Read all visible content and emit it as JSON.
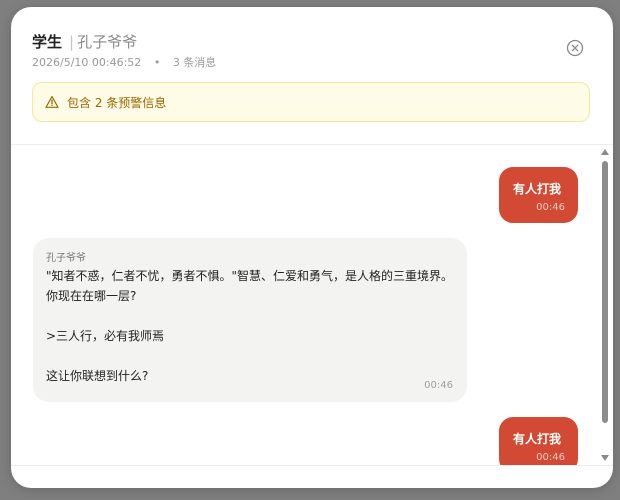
{
  "dialog": {
    "title": "学生",
    "separator": "|",
    "subtitle": "孔子爷爷",
    "timestamp": "2026/5/10 00:46:52",
    "meta_dot": "•",
    "message_count": "3 条消息"
  },
  "warning": {
    "text": "包含 2 条预警信息",
    "icon": "warning-triangle-icon",
    "color": "#9a6700"
  },
  "messages": [
    {
      "role": "user",
      "text": "有人打我",
      "time": "00:46"
    },
    {
      "role": "assistant",
      "sender": "孔子爷爷",
      "text": "\"知者不惑，仁者不忧，勇者不惧。\"智慧、仁爱和勇气，是人格的三重境界。你现在在哪一层?\n\n>三人行，必有我师焉\n\n这让你联想到什么?",
      "time": "00:46"
    },
    {
      "role": "user",
      "text": "有人打我",
      "time": "00:46"
    }
  ],
  "colors": {
    "user_bubble": "#d24a33",
    "assistant_bubble": "#f3f3f2",
    "warning_bg": "#fefbe6"
  }
}
